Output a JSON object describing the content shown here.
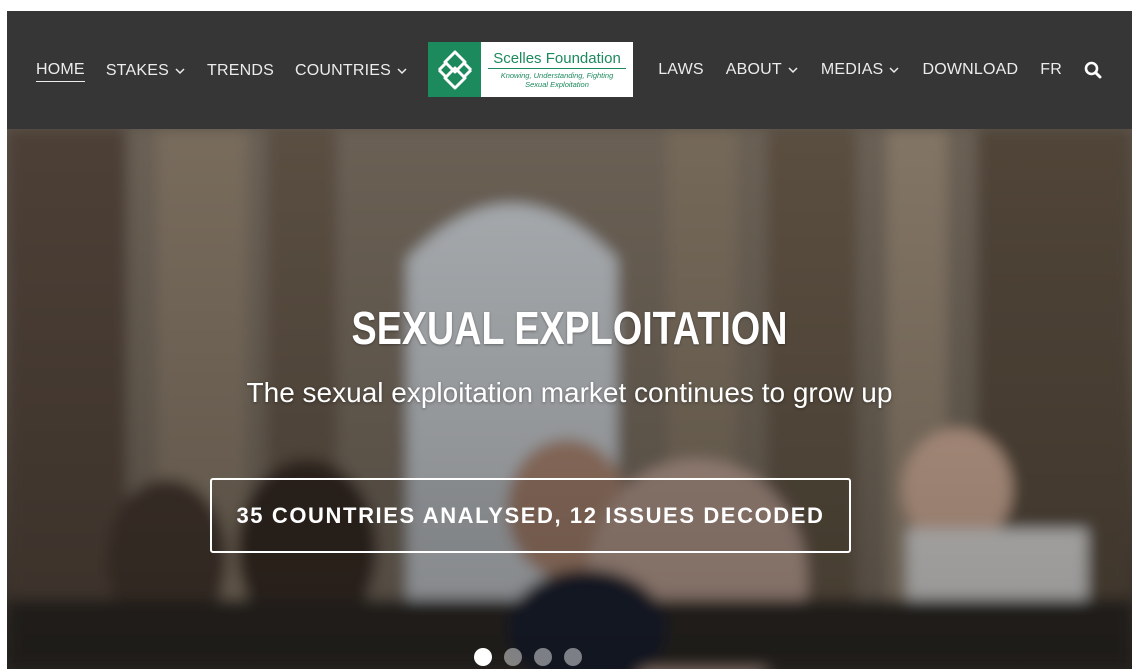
{
  "nav": {
    "left_items": [
      {
        "label": "HOME",
        "active": true,
        "dropdown": false
      },
      {
        "label": "STAKES",
        "active": false,
        "dropdown": true
      },
      {
        "label": "TRENDS",
        "active": false,
        "dropdown": false
      },
      {
        "label": "COUNTRIES",
        "active": false,
        "dropdown": true
      }
    ],
    "right_items": [
      {
        "label": "LAWS",
        "dropdown": false
      },
      {
        "label": "ABOUT",
        "dropdown": true
      },
      {
        "label": "MEDIAS",
        "dropdown": true
      },
      {
        "label": "DOWNLOAD",
        "dropdown": false
      },
      {
        "label": "FR",
        "dropdown": false
      }
    ],
    "search_icon": "search-icon"
  },
  "logo": {
    "name": "Scelles Foundation",
    "tagline_line1": "Knowing, Understanding, Fighting",
    "tagline_line2": "Sexual Exploitation",
    "color": "#1d8a5e"
  },
  "hero": {
    "title": "SEXUAL EXPLOITATION",
    "subtitle": "The sexual exploitation market continues to grow up",
    "button_label": "35 COUNTRIES ANALYSED, 12 ISSUES DECODED",
    "slides_total": 4,
    "active_slide": 1
  },
  "colors": {
    "navbar": "#363636",
    "nav_text": "#ececec",
    "accent": "#1d8a5e"
  }
}
